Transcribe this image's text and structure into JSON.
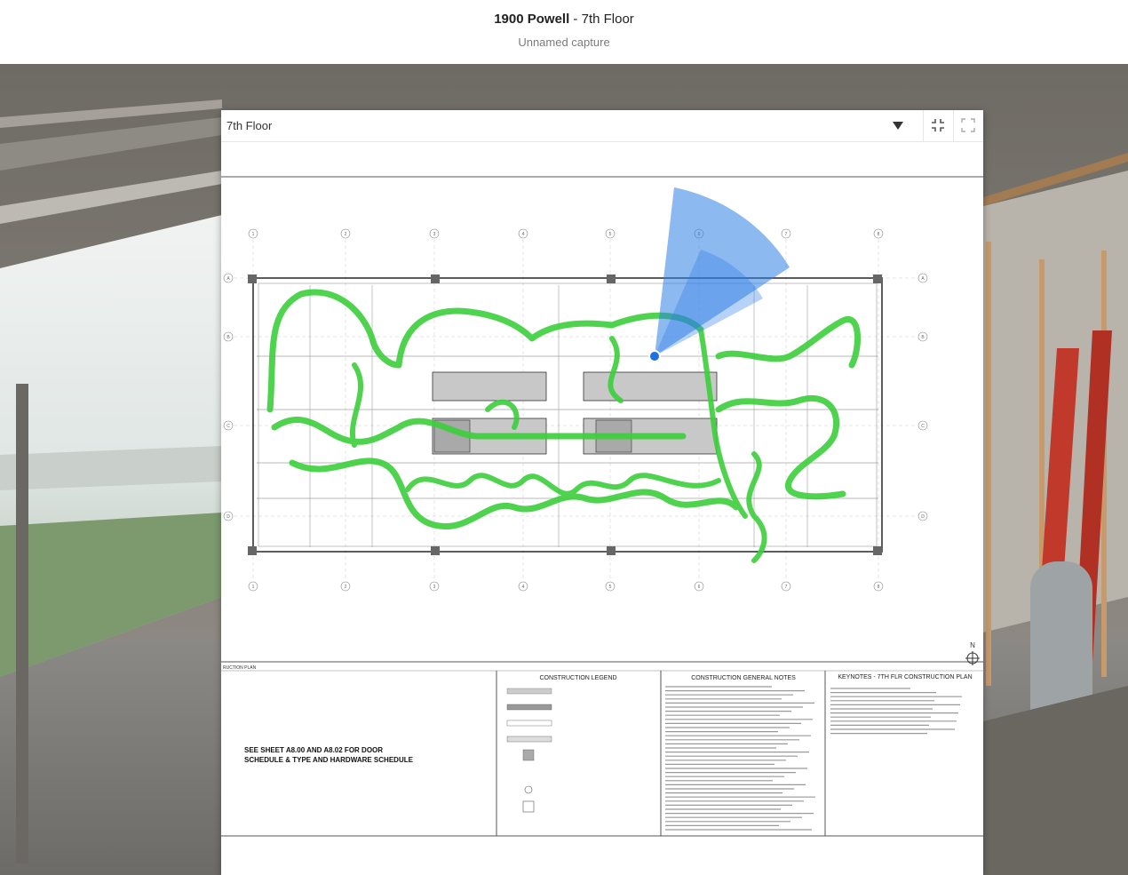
{
  "header": {
    "title": "1900 Powell",
    "title_suffix": " - 7th Floor",
    "subtitle": "Unnamed capture"
  },
  "minimap": {
    "floor_label": "7th Floor",
    "collapse_icon": "collapse-icon",
    "fullscreen_icon": "fullscreen-icon"
  },
  "plan": {
    "column_grid": [
      "1",
      "2",
      "3",
      "4",
      "5",
      "6",
      "7",
      "8"
    ],
    "row_grid": [
      "A",
      "B",
      "C",
      "D"
    ],
    "north_label": "N",
    "sheet_title": "RUCTION PLAN",
    "note": [
      "SEE SHEET A8.00 AND A8.02 FOR DOOR",
      "SCHEDULE & TYPE AND HARDWARE SCHEDULE"
    ],
    "legend_title": "CONSTRUCTION LEGEND",
    "general_notes_title": "CONSTRUCTION GENERAL NOTES",
    "keynotes_title": "KEYNOTES - 7TH FLR CONSTRUCTION PLAN"
  },
  "colors": {
    "path": "#3ccf3c",
    "view_cone": "#2f7fe6",
    "position_dot": "#1e6fe0"
  }
}
